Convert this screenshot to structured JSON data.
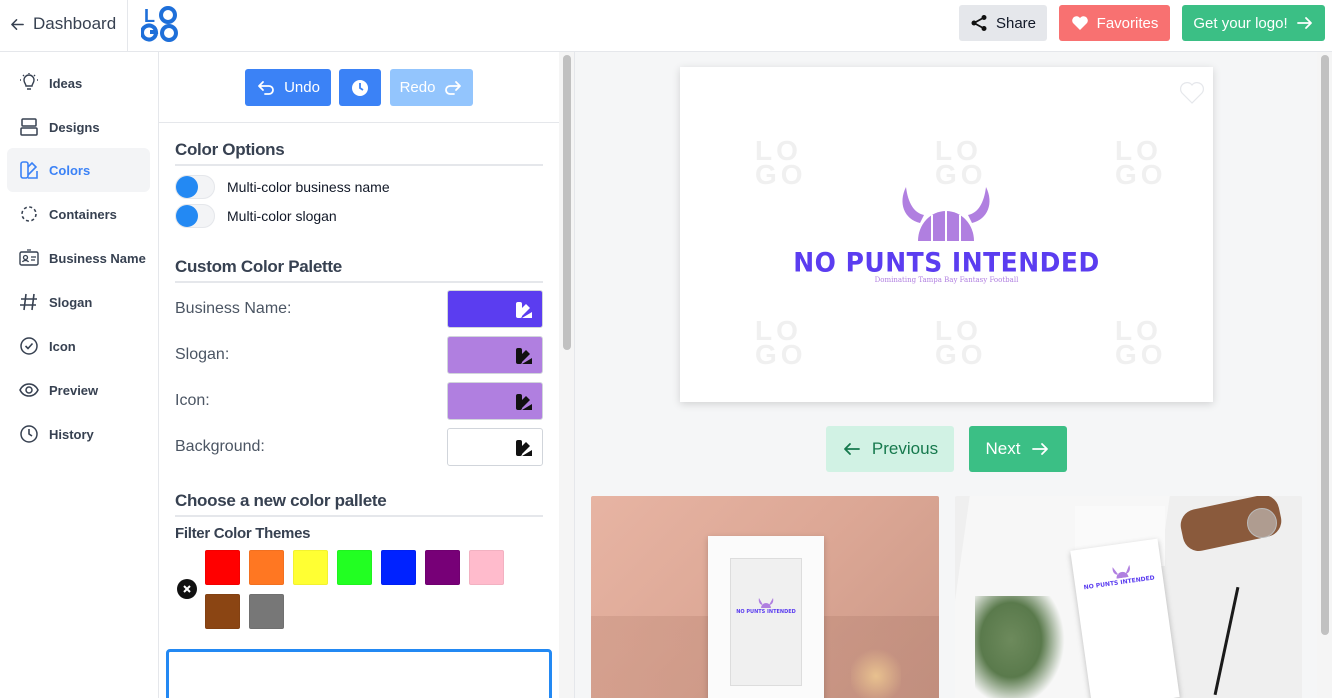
{
  "topbar": {
    "back_label": "Dashboard",
    "logo_text": "LOGO",
    "share_label": "Share",
    "favorites_label": "Favorites",
    "get_logo_label": "Get your logo!"
  },
  "sidebar": {
    "items": [
      {
        "label": "Ideas",
        "icon": "lightbulb-icon"
      },
      {
        "label": "Designs",
        "icon": "layers-icon"
      },
      {
        "label": "Colors",
        "icon": "palette-icon",
        "active": true
      },
      {
        "label": "Containers",
        "icon": "dashed-circle-icon"
      },
      {
        "label": "Business Name",
        "icon": "id-card-icon"
      },
      {
        "label": "Slogan",
        "icon": "hash-icon"
      },
      {
        "label": "Icon",
        "icon": "check-badge-icon"
      },
      {
        "label": "Preview",
        "icon": "eye-icon"
      },
      {
        "label": "History",
        "icon": "clock-icon"
      }
    ]
  },
  "history": {
    "undo_label": "Undo",
    "redo_label": "Redo"
  },
  "color_options": {
    "title": "Color Options",
    "toggles": [
      {
        "label": "Multi-color business name"
      },
      {
        "label": "Multi-color slogan"
      }
    ]
  },
  "custom_palette": {
    "title": "Custom Color Palette",
    "rows": [
      {
        "label": "Business Name:",
        "color": "#5b3df0"
      },
      {
        "label": "Slogan:",
        "color": "#b07fe0"
      },
      {
        "label": "Icon:",
        "color": "#b07fe0"
      },
      {
        "label": "Background:",
        "color": "#ffffff"
      }
    ]
  },
  "palette_chooser": {
    "title": "Choose a new color pallete",
    "filter_label": "Filter Color Themes",
    "chips": [
      {
        "name": "red",
        "color": "#ff0000"
      },
      {
        "name": "orange",
        "color": "#ff7722"
      },
      {
        "name": "yellow",
        "color": "#ffff33"
      },
      {
        "name": "green",
        "color": "#22ff22"
      },
      {
        "name": "blue",
        "color": "#0022ff"
      },
      {
        "name": "purple",
        "color": "#770077"
      },
      {
        "name": "pink",
        "color": "#ffbbcc"
      },
      {
        "name": "brown",
        "color": "#8b4513"
      },
      {
        "name": "gray",
        "color": "#777777"
      }
    ]
  },
  "preview": {
    "business_name": "NO PUNTS INTENDED",
    "slogan": "Dominating Tampa Bay Fantasy Football",
    "watermark": "LOGO",
    "previous_label": "Previous",
    "next_label": "Next",
    "mockup_name": "NO PUNTS INTENDED"
  },
  "colors": {
    "primary_blue": "#3b82f6",
    "accent_green": "#3bbf85",
    "favorites_red": "#f87171",
    "brand_name": "#5b3df0",
    "brand_icon": "#b07fe0"
  }
}
